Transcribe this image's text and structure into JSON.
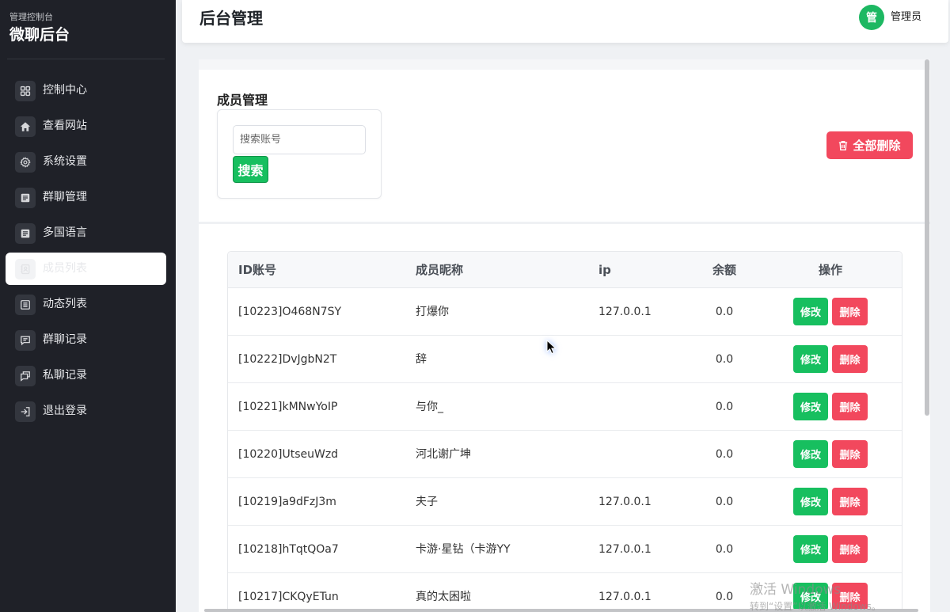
{
  "sidebar": {
    "subtitle": "管理控制台",
    "title": "微聊后台",
    "items": [
      {
        "label": "控制中心",
        "icon": "dashboard-icon"
      },
      {
        "label": "查看网站",
        "icon": "home-icon"
      },
      {
        "label": "系统设置",
        "icon": "gear-icon"
      },
      {
        "label": "群聊管理",
        "icon": "document-icon"
      },
      {
        "label": "多国语言",
        "icon": "document-icon"
      },
      {
        "label": "成员列表",
        "icon": "contacts-icon",
        "active": true
      },
      {
        "label": "动态列表",
        "icon": "list-icon"
      },
      {
        "label": "群聊记录",
        "icon": "message-icon"
      },
      {
        "label": "私聊记录",
        "icon": "chat-icon"
      },
      {
        "label": "退出登录",
        "icon": "logout-icon"
      }
    ]
  },
  "header": {
    "title": "后台管理",
    "avatar_text": "管",
    "user_name": "管理员"
  },
  "member_panel": {
    "title": "成员管理",
    "search_placeholder": "搜索账号",
    "search_button": "搜索",
    "delete_all_button": "全部删除",
    "delete_all_icon": "trash-icon"
  },
  "table": {
    "columns": [
      "ID账号",
      "成员昵称",
      "ip",
      "余额",
      "操作"
    ],
    "edit_label": "修改",
    "delete_label": "删除",
    "rows": [
      {
        "id": "[10223]O468N7SY",
        "nickname": "打爆你",
        "ip": "127.0.0.1",
        "balance": "0.0"
      },
      {
        "id": "[10222]DvJgbN2T",
        "nickname": "辞",
        "ip": "",
        "balance": "0.0"
      },
      {
        "id": "[10221]kMNwYoIP",
        "nickname": "与你_",
        "ip": "",
        "balance": "0.0"
      },
      {
        "id": "[10220]UtseuWzd",
        "nickname": "河北谢广坤",
        "ip": "",
        "balance": "0.0"
      },
      {
        "id": "[10219]a9dFzJ3m",
        "nickname": "夫子",
        "ip": "127.0.0.1",
        "balance": "0.0"
      },
      {
        "id": "[10218]hTqtQOa7",
        "nickname": "卡游·星钻（卡游YY",
        "ip": "127.0.0.1",
        "balance": "0.0"
      },
      {
        "id": "[10217]CKQyETun",
        "nickname": "真的太困啦",
        "ip": "127.0.0.1",
        "balance": "0.0"
      }
    ]
  },
  "watermark": {
    "line1": "激活 Windows",
    "line2": "转到“设置”以激活 Windows。"
  },
  "colors": {
    "sidebar_bg": "#1f2128",
    "primary_green": "#17bf5f",
    "danger_red": "#f2485d",
    "avatar_green": "#1db862"
  }
}
